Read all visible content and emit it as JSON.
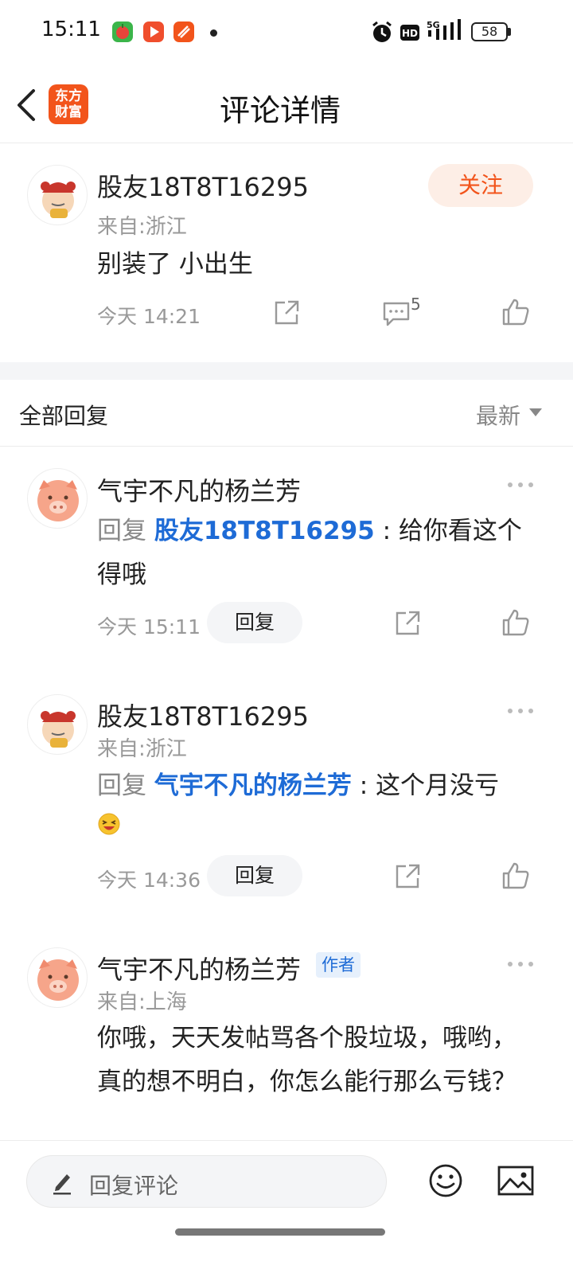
{
  "status_bar": {
    "time": "15:11",
    "battery": "58",
    "network": "5G",
    "hd": "HD"
  },
  "nav": {
    "title": "评论详情",
    "brand": "东方财富"
  },
  "main_comment": {
    "author": "股友18T8T16295",
    "location": "来自:浙江",
    "follow_label": "关注",
    "content": "别装了 小出生",
    "time": "今天 14:21",
    "comment_count": "5"
  },
  "replies_header": {
    "title": "全部回复",
    "sort": "最新"
  },
  "replies": [
    {
      "author": "气宇不凡的杨兰芳",
      "reply_prefix": "回复",
      "reply_target": "股友18T8T16295",
      "content": ": 给你看这个得哦",
      "time": "今天 15:11",
      "reply_label": "回复"
    },
    {
      "author": "股友18T8T16295",
      "location": "来自:浙江",
      "reply_prefix": "回复",
      "reply_target": "气宇不凡的杨兰芳",
      "content": ": 这个月没亏",
      "time": "今天 14:36",
      "reply_label": "回复"
    },
    {
      "author": "气宇不凡的杨兰芳",
      "badge": "作者",
      "location": "来自:上海",
      "content": "你哦，天天发帖骂各个股垃圾，哦哟，真的想不明白，你怎么能行那么亏钱？"
    }
  ],
  "bottom_bar": {
    "input_placeholder": "回复评论"
  },
  "colors": {
    "accent": "#f2541b",
    "link": "#1e6bd6",
    "muted": "#999999"
  }
}
